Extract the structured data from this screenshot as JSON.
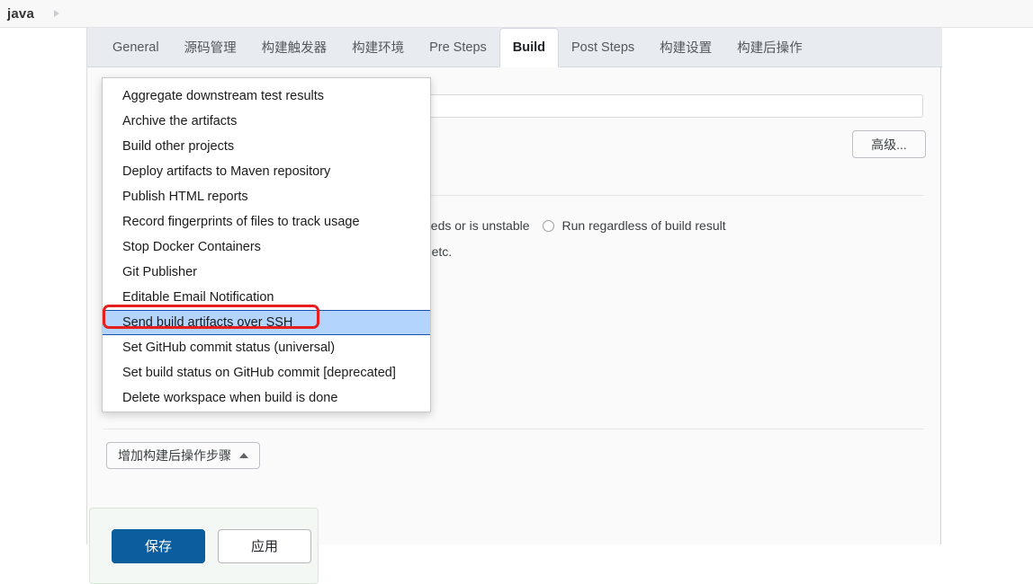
{
  "breadcrumb": {
    "items": [
      "java"
    ],
    "separator_icon": "chevron-right-icon"
  },
  "tabs": [
    {
      "label": "General",
      "active": false
    },
    {
      "label": "源码管理",
      "active": false
    },
    {
      "label": "构建触发器",
      "active": false
    },
    {
      "label": "构建环境",
      "active": false
    },
    {
      "label": "Pre Steps",
      "active": false
    },
    {
      "label": "Build",
      "active": true
    },
    {
      "label": "Post Steps",
      "active": false
    },
    {
      "label": "构建设置",
      "active": false
    },
    {
      "label": "构建后操作",
      "active": false
    }
  ],
  "content": {
    "advanced_button": "高级...",
    "radio_partial_label": "cceeds or is unstable",
    "radio_option_label": "Run regardless of build result",
    "description_partial": "ds, etc.",
    "add_step_button": "增加构建后操作步骤",
    "add_step_caret_icon": "caret-up-icon"
  },
  "submit_bar": {
    "save_label": "保存",
    "apply_label": "应用"
  },
  "dropdown": {
    "selected_index": 9,
    "items": [
      "Aggregate downstream test results",
      "Archive the artifacts",
      "Build other projects",
      "Deploy artifacts to Maven repository",
      "Publish HTML reports",
      "Record fingerprints of files to track usage",
      "Stop Docker Containers",
      "Git Publisher",
      "Editable Email Notification",
      "Send build artifacts over SSH",
      "Set GitHub commit status (universal)",
      "Set build status on GitHub commit [deprecated]",
      "Delete workspace when build is done"
    ]
  },
  "colors": {
    "accent_blue": "#0b5d9e",
    "selection_blue": "#b3d4fc",
    "selection_border": "#1a4fb0",
    "annotation_red": "#e81e1e",
    "tabbar_bg": "#e8ecf1",
    "submit_bar_bg": "#f4f8f4"
  }
}
